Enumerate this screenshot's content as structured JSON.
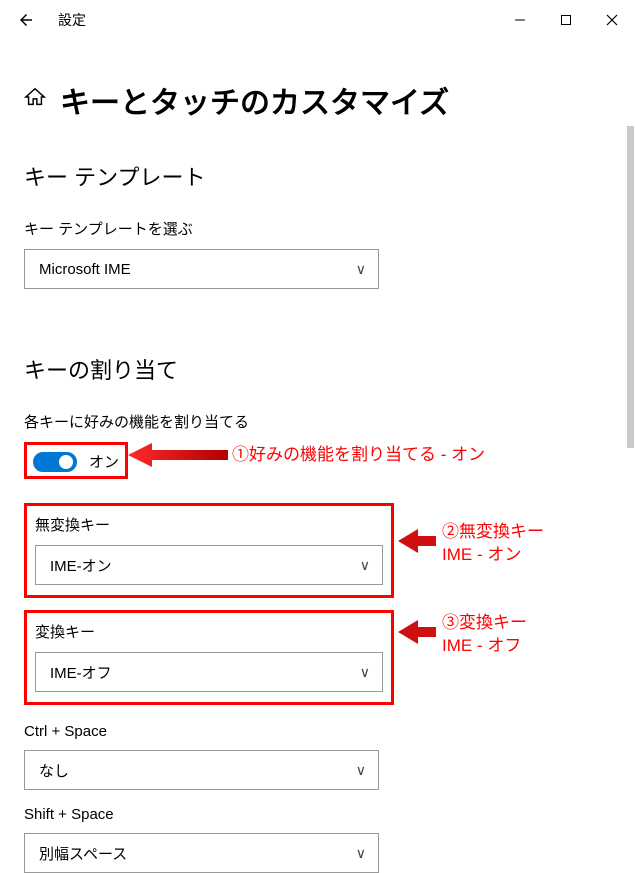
{
  "window": {
    "title": "設定"
  },
  "page": {
    "title": "キーとタッチのカスタマイズ"
  },
  "sections": {
    "template": {
      "title": "キー テンプレート",
      "label": "キー テンプレートを選ぶ",
      "value": "Microsoft IME"
    },
    "assignment": {
      "title": "キーの割り当て",
      "label": "各キーに好みの機能を割り当てる",
      "toggle_state": "オン",
      "fields": {
        "muhenkan": {
          "label": "無変換キー",
          "value": "IME-オン"
        },
        "henkan": {
          "label": "変換キー",
          "value": "IME-オフ"
        },
        "ctrlspace": {
          "label": "Ctrl + Space",
          "value": "なし"
        },
        "shiftspace": {
          "label": "Shift + Space",
          "value": "別幅スペース"
        }
      }
    }
  },
  "annotations": {
    "a1": "①好みの機能を割り当てる - オン",
    "a2_l1": "②無変換キー",
    "a2_l2": "IME - オン",
    "a3_l1": "③変換キー",
    "a3_l2": "IME - オフ"
  }
}
